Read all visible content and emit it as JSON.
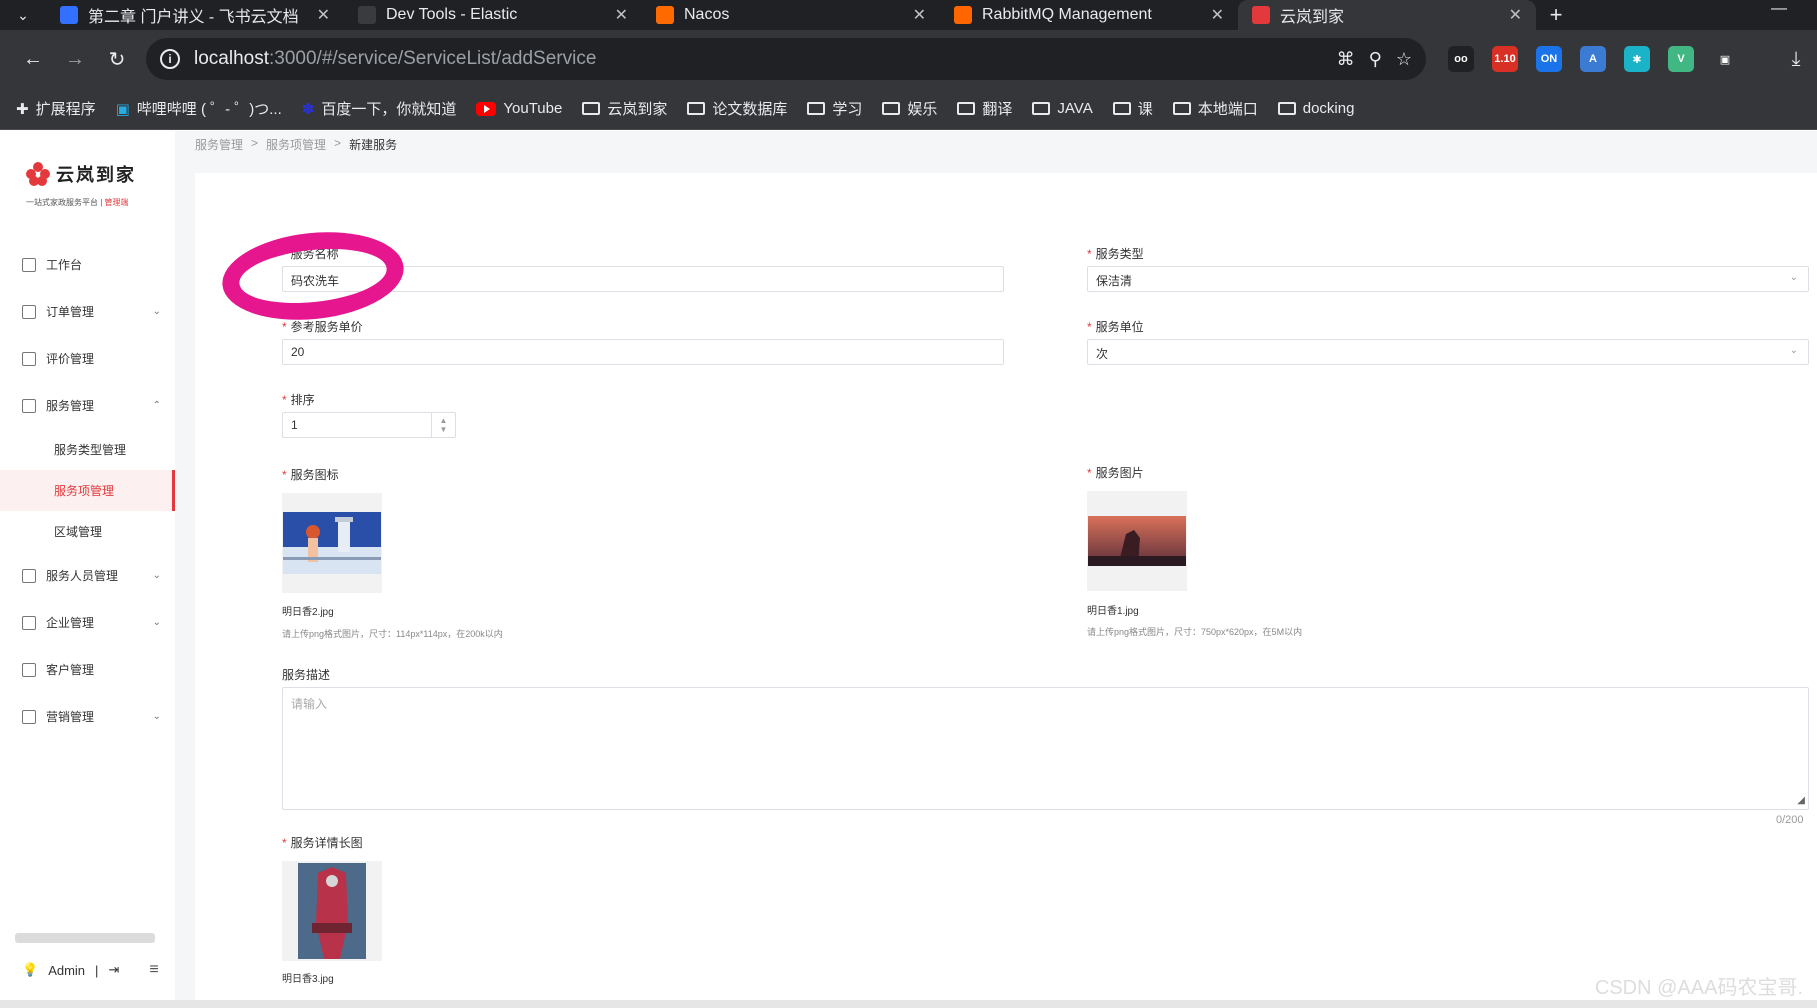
{
  "browser": {
    "tabs": [
      {
        "title": "第二章 门户讲义 - 飞书云文档",
        "fav_color": "#3370ff",
        "active": false
      },
      {
        "title": "Dev Tools - Elastic",
        "fav_color": "#3a3b3f",
        "active": false
      },
      {
        "title": "Nacos",
        "fav_color": "#ff6a00",
        "active": false
      },
      {
        "title": "RabbitMQ Management",
        "fav_color": "#ff6600",
        "active": false
      },
      {
        "title": "云岚到家",
        "fav_color": "#e4393c",
        "active": true
      }
    ],
    "new_tab_symbol": "+",
    "minimize_symbol": "—",
    "url_host": "localhost",
    "url_path": ":3000/#/service/ServiceList/addService",
    "extensions": [
      {
        "name": "glasses-ext-icon",
        "label": "oo",
        "color": "#202124"
      },
      {
        "name": "badge-ext-icon",
        "label": "1.10",
        "color": "#d93025"
      },
      {
        "name": "on-ext-icon",
        "label": "ON",
        "color": "#1a73e8"
      },
      {
        "name": "translate-ext-icon",
        "label": "A",
        "color": "#3c7bd4"
      },
      {
        "name": "bluetooth-ext-icon",
        "label": "✱",
        "color": "#1ab3c8"
      },
      {
        "name": "vue-ext-icon",
        "label": "V",
        "color": "#41b883"
      },
      {
        "name": "puzzle-ext-icon",
        "label": "▣",
        "color": "#35363a"
      }
    ],
    "bookmarks": [
      {
        "label": "扩展程序",
        "type": "puzzle"
      },
      {
        "label": "哔哩哔哩 ( ゜- ゜)つ...",
        "type": "bili"
      },
      {
        "label": "百度一下，你就知道",
        "type": "baidu"
      },
      {
        "label": "YouTube",
        "type": "youtube"
      },
      {
        "label": "云岚到家",
        "type": "folder"
      },
      {
        "label": "论文数据库",
        "type": "folder"
      },
      {
        "label": "学习",
        "type": "folder"
      },
      {
        "label": "娱乐",
        "type": "folder"
      },
      {
        "label": "翻译",
        "type": "folder"
      },
      {
        "label": "JAVA",
        "type": "folder"
      },
      {
        "label": "课",
        "type": "folder"
      },
      {
        "label": "本地端口",
        "type": "folder"
      },
      {
        "label": "docking",
        "type": "folder"
      }
    ]
  },
  "app": {
    "logo_text": "云岚到家",
    "logo_sub": "一站式家政服务平台",
    "logo_sub_admin": "管理端",
    "breadcrumb": [
      "服务管理",
      "服务项管理",
      "新建服务"
    ],
    "breadcrumb_sep": ">",
    "menu": [
      {
        "label": "工作台",
        "caret": ""
      },
      {
        "label": "订单管理",
        "caret": "⌄"
      },
      {
        "label": "评价管理",
        "caret": ""
      },
      {
        "label": "服务管理",
        "caret": "⌃"
      },
      {
        "label": "服务类型管理",
        "sub": true
      },
      {
        "label": "服务项管理",
        "sub": true,
        "active": true
      },
      {
        "label": "区域管理",
        "sub": true
      },
      {
        "label": "服务人员管理",
        "caret": "⌄"
      },
      {
        "label": "企业管理",
        "caret": "⌄"
      },
      {
        "label": "客户管理",
        "caret": ""
      },
      {
        "label": "营销管理",
        "caret": "⌄"
      }
    ],
    "user": "Admin",
    "user_sep": "|"
  },
  "form": {
    "service_name": {
      "label": "服务名称",
      "value": "码农洗车"
    },
    "service_type": {
      "label": "服务类型",
      "value": "保洁清"
    },
    "price": {
      "label": "参考服务单价",
      "value": "20"
    },
    "unit": {
      "label": "服务单位",
      "value": "次"
    },
    "sort": {
      "label": "排序",
      "value": "1"
    },
    "icon": {
      "label": "服务图标",
      "file": "明日香2.jpg",
      "hint": "请上传png格式图片，尺寸：114px*114px，在200k以内"
    },
    "image": {
      "label": "服务图片",
      "file": "明日香1.jpg",
      "hint": "请上传png格式图片，尺寸：750px*620px，在5M以内"
    },
    "desc": {
      "label": "服务描述",
      "placeholder": "请输入",
      "counter": "0/200"
    },
    "detail": {
      "label": "服务详情长图",
      "file": "明日香3.jpg"
    }
  },
  "watermark": "CSDN @AAA码农宝哥."
}
